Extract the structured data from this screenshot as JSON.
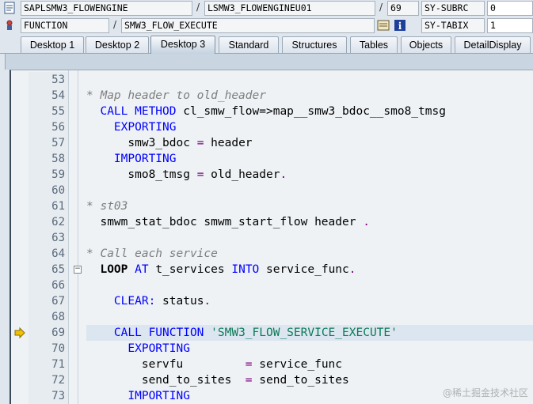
{
  "info": {
    "program": "SAPLSMW3_FLOWENGINE",
    "include": "LSMW3_FLOWENGINEU01",
    "line": "69",
    "sysvar1_name": "SY-SUBRC",
    "sysvar1_value": "0",
    "type": "FUNCTION",
    "name": "SMW3_FLOW_EXECUTE",
    "sysvar2_name": "SY-TABIX",
    "sysvar2_value": "1",
    "separator": "/"
  },
  "tabs": [
    {
      "label": "Desktop 1"
    },
    {
      "label": "Desktop 2"
    },
    {
      "label": "Desktop 3"
    },
    {
      "label": "Standard"
    },
    {
      "label": "Structures"
    },
    {
      "label": "Tables"
    },
    {
      "label": "Objects"
    },
    {
      "label": "DetailDisplay"
    }
  ],
  "active_tab": "Desktop 3",
  "current_line": "69",
  "code": [
    {
      "n": "53",
      "parts": []
    },
    {
      "n": "54",
      "parts": [
        [
          "cm",
          "* Map header to old_header"
        ]
      ]
    },
    {
      "n": "55",
      "parts": [
        [
          "sp",
          "  "
        ],
        [
          "kw",
          "CALL METHOD"
        ],
        [
          "tx",
          " cl_smw_flow=>map__smw3_bdoc__smo8_tmsg"
        ]
      ]
    },
    {
      "n": "56",
      "parts": [
        [
          "sp",
          "    "
        ],
        [
          "kw",
          "EXPORTING"
        ]
      ]
    },
    {
      "n": "57",
      "parts": [
        [
          "tx",
          "      smw3_bdoc "
        ],
        [
          "op",
          "="
        ],
        [
          "tx",
          " header"
        ]
      ]
    },
    {
      "n": "58",
      "parts": [
        [
          "sp",
          "    "
        ],
        [
          "kw",
          "IMPORTING"
        ]
      ]
    },
    {
      "n": "59",
      "parts": [
        [
          "tx",
          "      smo8_tmsg "
        ],
        [
          "op",
          "="
        ],
        [
          "tx",
          " old_header"
        ],
        [
          "op",
          "."
        ]
      ]
    },
    {
      "n": "60",
      "parts": []
    },
    {
      "n": "61",
      "parts": [
        [
          "cm",
          "* st03"
        ]
      ]
    },
    {
      "n": "62",
      "parts": [
        [
          "tx",
          "  smwm_stat_bdoc smwm_start_flow header "
        ],
        [
          "op",
          "."
        ]
      ]
    },
    {
      "n": "63",
      "parts": []
    },
    {
      "n": "64",
      "parts": [
        [
          "cm",
          "* Call each service"
        ]
      ]
    },
    {
      "n": "65",
      "parts": [
        [
          "sp",
          "  "
        ],
        [
          "kwb",
          "LOOP"
        ],
        [
          "tx",
          " "
        ],
        [
          "kw",
          "AT"
        ],
        [
          "tx",
          " t_services "
        ],
        [
          "kw",
          "INTO"
        ],
        [
          "tx",
          " service_func"
        ],
        [
          "op",
          "."
        ]
      ]
    },
    {
      "n": "66",
      "parts": []
    },
    {
      "n": "67",
      "parts": [
        [
          "sp",
          "    "
        ],
        [
          "kw",
          "CLEAR:"
        ],
        [
          "tx",
          " status"
        ],
        [
          "op",
          "."
        ]
      ]
    },
    {
      "n": "68",
      "parts": []
    },
    {
      "n": "69",
      "parts": [
        [
          "sp",
          "    "
        ],
        [
          "kw",
          "CALL FUNCTION"
        ],
        [
          "tx",
          " "
        ],
        [
          "st",
          "'SMW3_FLOW_SERVICE_EXECUTE'"
        ]
      ]
    },
    {
      "n": "70",
      "parts": [
        [
          "sp",
          "      "
        ],
        [
          "kw",
          "EXPORTING"
        ]
      ]
    },
    {
      "n": "71",
      "parts": [
        [
          "tx",
          "        servfu         "
        ],
        [
          "op",
          "="
        ],
        [
          "tx",
          " service_func"
        ]
      ]
    },
    {
      "n": "72",
      "parts": [
        [
          "tx",
          "        send_to_sites  "
        ],
        [
          "op",
          "="
        ],
        [
          "tx",
          " send_to_sites"
        ]
      ]
    },
    {
      "n": "73",
      "parts": [
        [
          "sp",
          "      "
        ],
        [
          "kw",
          "IMPORTING"
        ]
      ]
    }
  ],
  "watermark": "@稀土掘金技术社区"
}
